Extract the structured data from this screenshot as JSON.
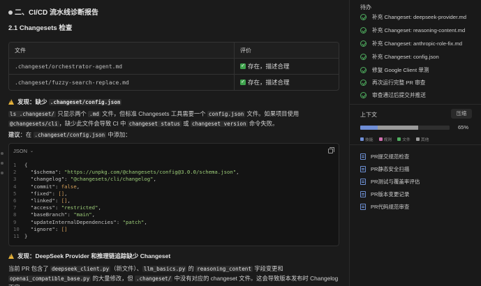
{
  "doc": {
    "h1": "二、CI/CD 流水线诊断报告",
    "h2": "2.1 Changesets 检查",
    "table": {
      "headers": [
        "文件",
        "评价"
      ],
      "rows": [
        {
          "file": ".changeset/orchestrator-agent.md",
          "eval": "存在，描述合理"
        },
        {
          "file": ".changeset/fuzzy-search-replace.md",
          "eval": "存在，描述合理"
        }
      ]
    },
    "finding1": {
      "prefix": "发现：缺少",
      "code": ".changeset/config.json"
    },
    "para1": {
      "c1": "ls .changeset/",
      "t1": " 只显示两个 ",
      "c2": ".md",
      "t2": " 文件，但标准 Changesets 工具需要一个 ",
      "c3": "config.json",
      "t3": " 文件。如果项目使用",
      "c4": "@changesets/cli",
      "t4": "，缺少此文件会导致 CI 中 ",
      "c5": "changeset status",
      "t5": " 或 ",
      "c6": "changeset version",
      "t6": " 命令失败。"
    },
    "suggestion": {
      "label": "建议",
      "t1": "：在 ",
      "code": ".changeset/config.json",
      "t2": " 中添加："
    },
    "code": {
      "lang": "JSON",
      "lines": [
        {
          "n": "1",
          "text": "{"
        },
        {
          "n": "2",
          "key": "\"$schema\"",
          "val": "\"https://unpkg.com/@changesets/config@3.0.0/schema.json\"",
          "tail": ","
        },
        {
          "n": "3",
          "key": "\"changelog\"",
          "val": "\"@changesets/cli/changelog\"",
          "tail": ","
        },
        {
          "n": "4",
          "key": "\"commit\"",
          "val": "false",
          "tail": ","
        },
        {
          "n": "5",
          "key": "\"fixed\"",
          "val": "[]",
          "tail": ","
        },
        {
          "n": "6",
          "key": "\"linked\"",
          "val": "[]",
          "tail": ","
        },
        {
          "n": "7",
          "key": "\"access\"",
          "val": "\"restricted\"",
          "tail": ","
        },
        {
          "n": "8",
          "key": "\"baseBranch\"",
          "val": "\"main\"",
          "tail": ","
        },
        {
          "n": "9",
          "key": "\"updateInternalDependencies\"",
          "val": "\"patch\"",
          "tail": ","
        },
        {
          "n": "10",
          "key": "\"ignore\"",
          "val": "[]",
          "tail": ""
        },
        {
          "n": "11",
          "text": "}"
        }
      ]
    },
    "finding2": "发现：DeepSeek Provider 和推理链追踪缺少 Changeset",
    "para2": {
      "t1": "当前 PR 包含了 ",
      "c1": "deepseek_client.py",
      "t2": "（新文件）、",
      "c2": "llm_basics.py",
      "t3": " 的 ",
      "c3": "reasoning_content",
      "t4": " 字段变更和",
      "c4": "openai_compatible_base.py",
      "t5": " 的大量修改，但 ",
      "c5": ".changeset/",
      "t6": " 中没有对应的 changeset 文件。这会导致版本发布时 Changelog 不完"
    }
  },
  "sidebar": {
    "title": "待办",
    "todos": [
      "补充 Changeset: deepseek-provider.md",
      "补充 Changeset: reasoning-content.md",
      "补充 Changeset: anthropic-role-fix.md",
      "补充 Changeset: config.json",
      "修复 Google Client 单测",
      "再次运行完整 PR 审查",
      "审查通过后提交并推送"
    ],
    "context_title": "上下文",
    "compress_label": "压缩",
    "usage_percent": "65%",
    "usage_fraction": 0.65,
    "legend": [
      "技能",
      "规则",
      "文件",
      "其他"
    ],
    "legend_colors": [
      "#6f8ed6",
      "#d16fb0",
      "#4fae5f",
      "#9a9a9a"
    ],
    "links": [
      "PR提交规范检查",
      "PR静态安全扫描",
      "PR测试与覆盖率评估",
      "PR版本变更记录",
      "PR代码规范审查"
    ]
  }
}
